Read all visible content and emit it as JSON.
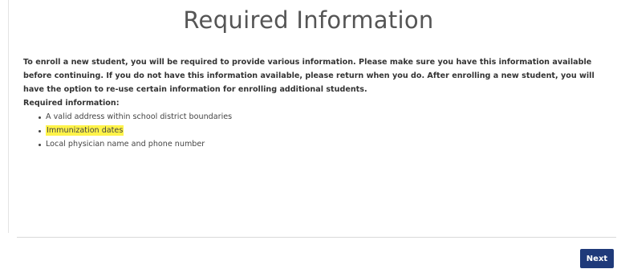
{
  "page": {
    "title": "Required Information"
  },
  "content": {
    "intro": "To enroll a new student, you will be required to provide various information. Please make sure you have this information available before continuing. If you do not have this information available, please return when you do. After enrolling a new student, you will have the option to re-use certain information for enrolling additional students.",
    "required_heading": "Required information:",
    "required_items": [
      {
        "label": "A valid address within school district boundaries",
        "highlighted": false
      },
      {
        "label": "Immunization dates",
        "highlighted": true
      },
      {
        "label": "Local physician name and phone number",
        "highlighted": false
      }
    ]
  },
  "footer": {
    "next_label": "Next"
  },
  "colors": {
    "highlight": "#fff34a",
    "primary_button": "#1f3a7a"
  }
}
